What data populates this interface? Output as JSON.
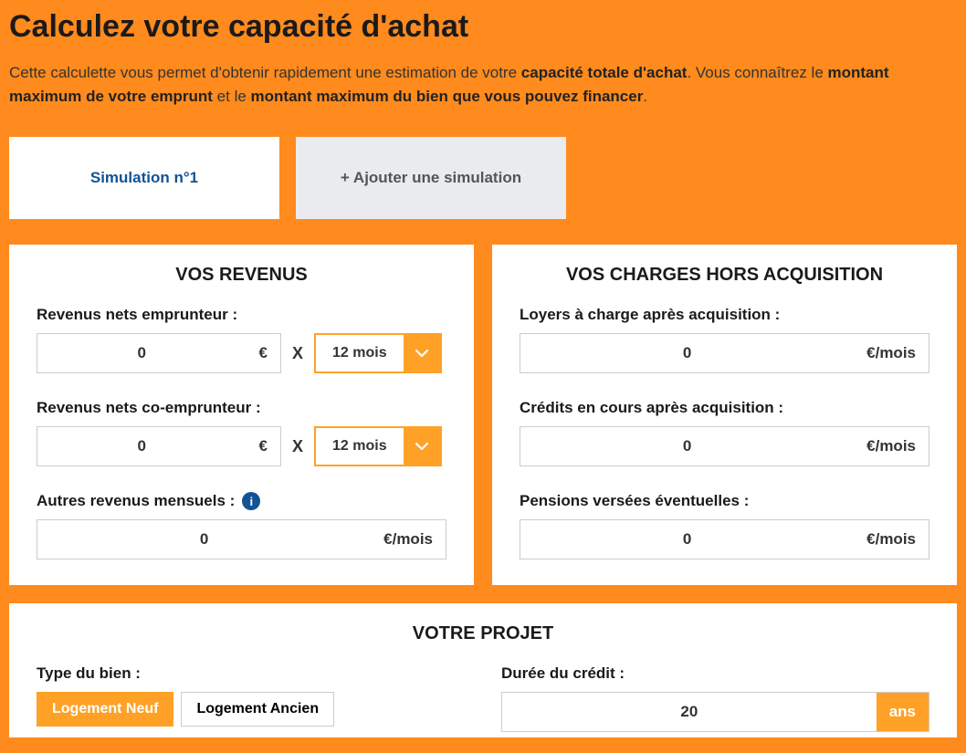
{
  "colors": {
    "accent": "#ffa126",
    "primary": "#135393",
    "bg": "#ff8a1d"
  },
  "title": "Calculez votre capacité d'achat",
  "intro": {
    "p1": "Cette calculette vous permet d'obtenir rapidement une estimation de votre ",
    "b1": "capacité totale d'achat",
    "p2": ". Vous connaîtrez le ",
    "b2": "montant maximum de votre emprunt",
    "p3": " et le ",
    "b3": "montant maximum du bien que vous pouvez financer",
    "p4": "."
  },
  "tabs": {
    "simulation": "Simulation n°1",
    "add": "+ Ajouter une simulation"
  },
  "revenus": {
    "title": "VOS REVENUS",
    "emprunteur_label": "Revenus nets emprunteur :",
    "emprunteur_value": "0",
    "unit_euro": "€",
    "mult": "X",
    "period_value": "12 mois",
    "co_label": "Revenus nets co-emprunteur :",
    "co_value": "0",
    "co_period_value": "12 mois",
    "autres_label": "Autres revenus mensuels :",
    "autres_value": "0",
    "unit_euro_mois": "€/mois"
  },
  "charges": {
    "title": "VOS CHARGES HORS ACQUISITION",
    "loyers_label": "Loyers à charge après acquisition :",
    "loyers_value": "0",
    "credits_label": "Crédits en cours après acquisition :",
    "credits_value": "0",
    "pensions_label": "Pensions versées éventuelles :",
    "pensions_value": "0",
    "unit": "€/mois"
  },
  "projet": {
    "title": "VOTRE PROJET",
    "type_label": "Type du bien :",
    "type_neuf": "Logement Neuf",
    "type_ancien": "Logement Ancien",
    "duree_label": "Durée du crédit :",
    "duree_value": "20",
    "duree_unit": "ans"
  },
  "icons": {
    "info": "i"
  }
}
